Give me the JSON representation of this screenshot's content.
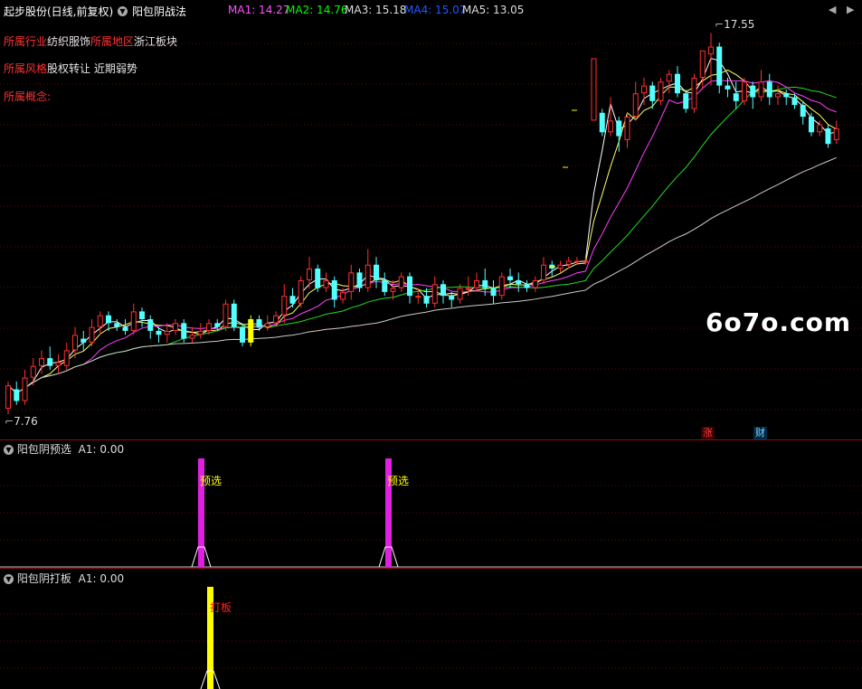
{
  "header": {
    "title": "起步股份(日线,前复权)",
    "indicator": "阳包阴战法",
    "ma": [
      {
        "label": "MA1: 14.27",
        "color": "#ff50ff"
      },
      {
        "label": "MA2: 14.76",
        "color": "#00ff00"
      },
      {
        "label": "MA3: 15.18",
        "color": "#dddddd"
      },
      {
        "label": "MA4: 15.07",
        "color": "#1e5aff"
      },
      {
        "label": "MA5: 13.05",
        "color": "#dddddd"
      }
    ]
  },
  "info": {
    "industry_key": "所属行业",
    "industry_val": "纺织服饰",
    "region_key": "所属地区",
    "region_val": "浙江板块",
    "style_key": "所属风格",
    "style_val": "股权转让 近期弱势",
    "concept_key": "所属概念:"
  },
  "price": {
    "high_label": "17.55",
    "low_label": "7.76"
  },
  "badges": {
    "zhang": "涨",
    "cai": "财"
  },
  "watermark": "6o7o.com",
  "panel2": {
    "title": "阳包阴预选",
    "value": "A1: 0.00",
    "signal": "预选"
  },
  "panel3": {
    "title": "阳包阴打板",
    "value": "A1: 0.00",
    "signal": "打板"
  },
  "chart_data": {
    "type": "candlestick",
    "price_range": [
      7.76,
      17.55
    ],
    "candles": [
      [
        7.9,
        8.5,
        7.76,
        8.6
      ],
      [
        8.4,
        8.1,
        8.0,
        8.6
      ],
      [
        8.1,
        8.7,
        8.0,
        8.9
      ],
      [
        8.7,
        9.0,
        8.5,
        9.2
      ],
      [
        9.0,
        9.2,
        8.8,
        9.4
      ],
      [
        9.2,
        9.0,
        8.9,
        9.5
      ],
      [
        9.0,
        9.1,
        8.8,
        9.3
      ],
      [
        9.0,
        9.4,
        8.9,
        9.6
      ],
      [
        9.4,
        9.8,
        9.2,
        10.0
      ],
      [
        9.7,
        9.6,
        9.4,
        9.9
      ],
      [
        9.6,
        10.0,
        9.5,
        10.2
      ],
      [
        10.0,
        10.3,
        9.8,
        10.4
      ],
      [
        10.3,
        10.1,
        9.9,
        10.4
      ],
      [
        10.1,
        10.0,
        9.9,
        10.2
      ],
      [
        10.0,
        9.9,
        9.8,
        10.2
      ],
      [
        9.9,
        10.4,
        9.8,
        10.6
      ],
      [
        10.4,
        10.2,
        10.0,
        10.5
      ],
      [
        10.2,
        9.9,
        9.7,
        10.3
      ],
      [
        9.9,
        9.8,
        9.6,
        10.0
      ],
      [
        9.8,
        9.9,
        9.6,
        10.1
      ],
      [
        9.9,
        10.1,
        9.8,
        10.2
      ],
      [
        10.1,
        9.7,
        9.6,
        10.2
      ],
      [
        9.7,
        9.8,
        9.6,
        10.0
      ],
      [
        9.8,
        9.9,
        9.7,
        10.1
      ],
      [
        9.9,
        10.1,
        9.8,
        10.2
      ],
      [
        10.1,
        10.0,
        9.9,
        10.2
      ],
      [
        10.0,
        10.6,
        9.9,
        10.7
      ],
      [
        10.6,
        10.0,
        9.9,
        10.7
      ],
      [
        10.0,
        9.6,
        9.5,
        10.1
      ],
      [
        9.6,
        10.2,
        9.5,
        10.3
      ],
      [
        10.2,
        10.0,
        9.9,
        10.3
      ],
      [
        10.0,
        10.1,
        9.9,
        10.3
      ],
      [
        10.1,
        10.3,
        10.0,
        10.4
      ],
      [
        10.3,
        10.8,
        10.1,
        11.1
      ],
      [
        10.8,
        10.6,
        10.5,
        11.0
      ],
      [
        10.6,
        11.2,
        10.5,
        11.3
      ],
      [
        11.2,
        11.5,
        11.0,
        11.8
      ],
      [
        11.5,
        11.0,
        10.9,
        11.6
      ],
      [
        11.0,
        11.2,
        10.9,
        11.4
      ],
      [
        11.2,
        10.7,
        10.5,
        11.3
      ],
      [
        10.7,
        10.9,
        10.6,
        11.0
      ],
      [
        10.9,
        11.4,
        10.7,
        11.6
      ],
      [
        11.4,
        11.0,
        10.9,
        11.5
      ],
      [
        11.0,
        11.6,
        10.9,
        12.0
      ],
      [
        11.6,
        11.2,
        11.0,
        11.8
      ],
      [
        11.2,
        10.9,
        10.8,
        11.4
      ],
      [
        10.9,
        11.0,
        10.7,
        11.2
      ],
      [
        11.0,
        11.3,
        10.9,
        11.4
      ],
      [
        11.3,
        10.8,
        10.6,
        11.4
      ],
      [
        10.8,
        10.8,
        10.6,
        11.0
      ],
      [
        10.8,
        10.6,
        10.5,
        11.0
      ],
      [
        10.6,
        11.1,
        10.5,
        11.3
      ],
      [
        11.1,
        10.8,
        10.6,
        11.2
      ],
      [
        10.8,
        10.7,
        10.5,
        10.9
      ],
      [
        10.7,
        11.0,
        10.6,
        11.1
      ],
      [
        11.0,
        11.0,
        10.8,
        11.3
      ],
      [
        11.0,
        11.2,
        10.9,
        11.4
      ],
      [
        11.2,
        11.0,
        10.8,
        11.5
      ],
      [
        11.0,
        10.8,
        10.6,
        11.2
      ],
      [
        10.8,
        11.3,
        10.7,
        11.4
      ],
      [
        11.3,
        11.2,
        11.0,
        11.5
      ],
      [
        11.2,
        11.1,
        10.9,
        11.4
      ],
      [
        11.1,
        11.0,
        10.9,
        11.2
      ],
      [
        11.0,
        11.2,
        10.9,
        11.3
      ],
      [
        11.2,
        11.6,
        11.1,
        11.8
      ],
      [
        11.6,
        11.5,
        11.3,
        11.7
      ],
      [
        11.5,
        11.6,
        11.4,
        11.7
      ],
      [
        11.6,
        11.7,
        11.5,
        11.8
      ],
      [
        11.7,
        11.7,
        11.6,
        11.8
      ],
      [
        11.7,
        11.7,
        11.6,
        11.8
      ],
      [
        15.3,
        16.9,
        15.3,
        16.9
      ],
      [
        15.5,
        15.0,
        14.9,
        15.6
      ],
      [
        15.0,
        15.3,
        14.9,
        15.9
      ],
      [
        15.3,
        14.9,
        14.5,
        15.4
      ],
      [
        14.8,
        15.4,
        14.6,
        15.5
      ],
      [
        15.4,
        16.0,
        15.3,
        16.3
      ],
      [
        16.0,
        16.2,
        15.7,
        16.4
      ],
      [
        16.2,
        15.8,
        15.6,
        16.3
      ],
      [
        15.8,
        16.3,
        15.7,
        16.4
      ],
      [
        16.3,
        16.5,
        16.0,
        16.6
      ],
      [
        16.5,
        16.0,
        15.9,
        16.7
      ],
      [
        16.0,
        15.6,
        15.5,
        16.1
      ],
      [
        15.6,
        16.4,
        15.5,
        16.5
      ],
      [
        16.4,
        17.1,
        16.1,
        17.1
      ],
      [
        17.0,
        17.2,
        16.2,
        17.55
      ],
      [
        17.2,
        16.2,
        16.0,
        17.3
      ],
      [
        16.2,
        16.1,
        15.9,
        16.4
      ],
      [
        16.0,
        15.8,
        15.6,
        16.3
      ],
      [
        15.8,
        16.3,
        15.7,
        16.4
      ],
      [
        16.2,
        15.9,
        15.6,
        16.3
      ],
      [
        15.9,
        16.3,
        15.8,
        16.6
      ],
      [
        16.3,
        15.9,
        15.7,
        16.5
      ],
      [
        15.9,
        16.0,
        15.7,
        16.2
      ],
      [
        16.0,
        15.9,
        15.7,
        16.1
      ],
      [
        15.9,
        15.7,
        15.6,
        16.0
      ],
      [
        15.7,
        15.4,
        15.2,
        15.8
      ],
      [
        15.4,
        15.0,
        14.9,
        15.5
      ],
      [
        15.0,
        15.2,
        14.9,
        15.3
      ],
      [
        15.1,
        14.7,
        14.6,
        15.2
      ],
      [
        14.8,
        15.1,
        14.7,
        15.3
      ]
    ],
    "signals": {
      "preselect_index": [
        28,
        56
      ],
      "limit_up_index": [
        29
      ]
    }
  }
}
